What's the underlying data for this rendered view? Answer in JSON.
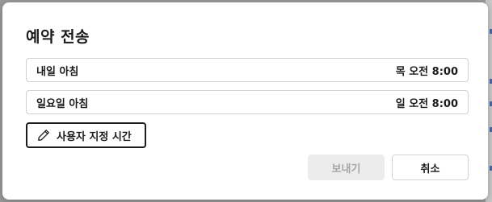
{
  "dialog": {
    "title": "예약 전송",
    "options": [
      {
        "label": "내일 아침",
        "time": "목 오전 8:00"
      },
      {
        "label": "일요일 아침",
        "time": "일 오전 8:00"
      }
    ],
    "custom_time_label": "사용자 지정 시간",
    "send_label": "보내기",
    "cancel_label": "취소"
  },
  "icons": {
    "custom_time": "pencil-icon"
  },
  "colors": {
    "accent_border": "#1b1b1b",
    "disabled_bg": "#ececec",
    "disabled_text": "#a6a6a6",
    "link_blue": "#4a6aa8"
  }
}
